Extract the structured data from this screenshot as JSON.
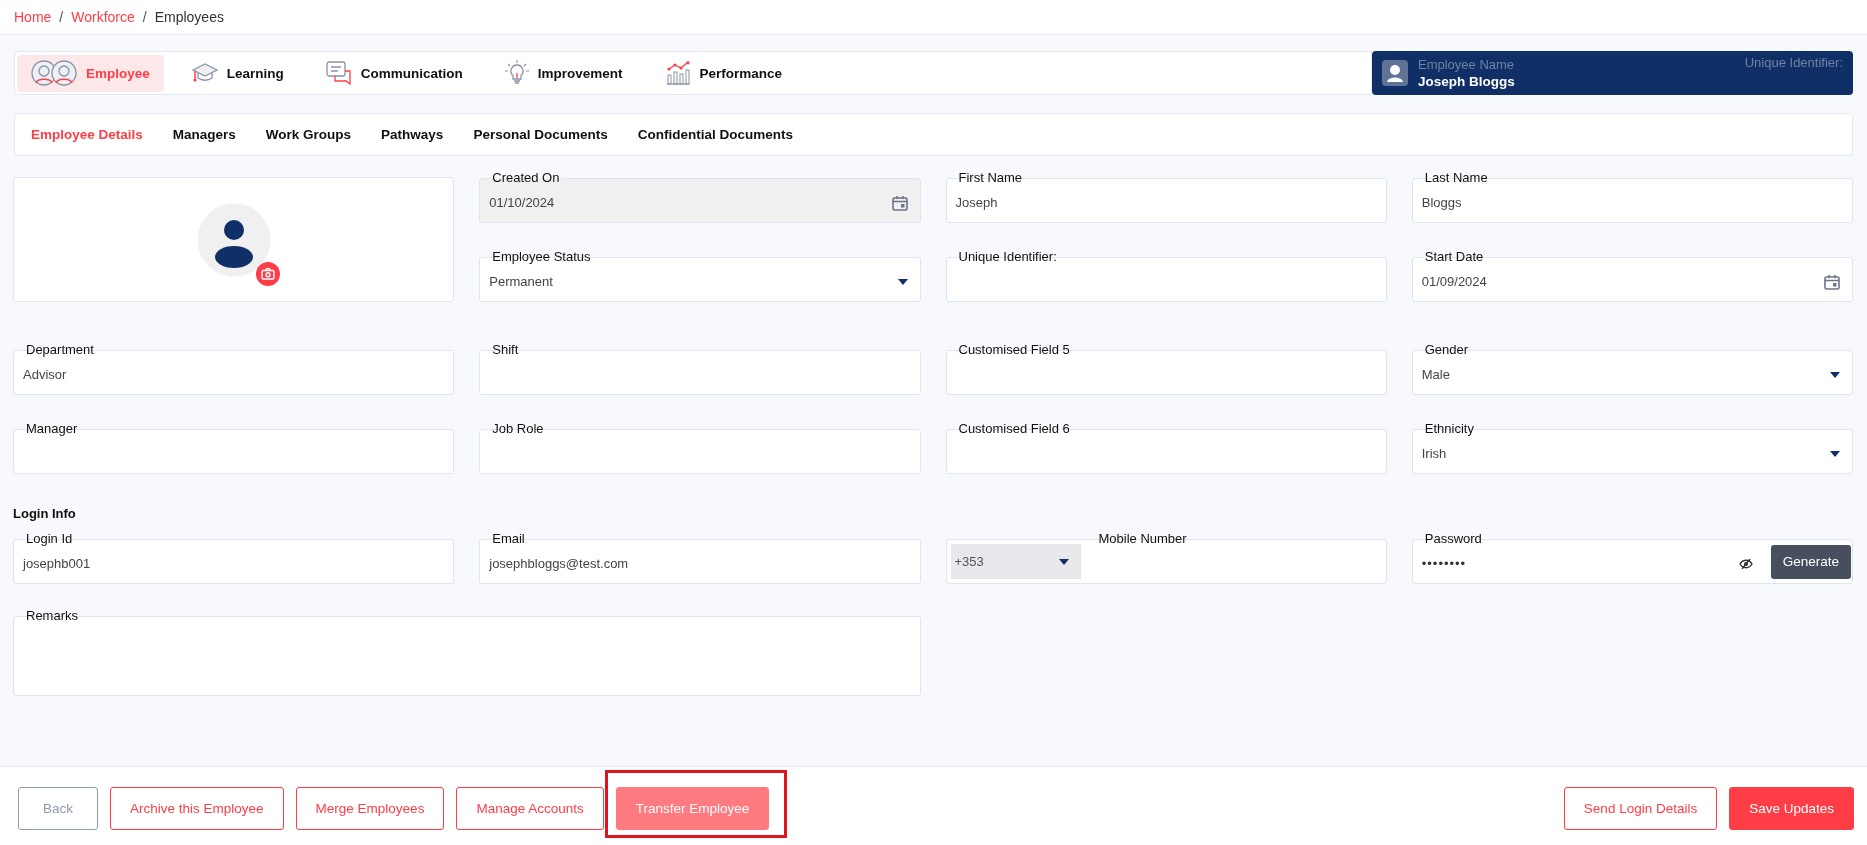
{
  "breadcrumb": [
    {
      "label": "Home",
      "kind": "link"
    },
    {
      "label": "Workforce",
      "kind": "link",
      "separator": "/"
    },
    {
      "label": "Employees",
      "kind": "current",
      "separator": "/"
    }
  ],
  "modules": [
    {
      "label": "Employee",
      "selected": true
    },
    {
      "label": "Learning",
      "selected": false
    },
    {
      "label": "Communication",
      "selected": false
    },
    {
      "label": "Improvement",
      "selected": false
    },
    {
      "label": "Performance",
      "selected": false
    }
  ],
  "employee_card": {
    "name_label": "Employee Name",
    "name": "Joseph Bloggs",
    "id_label": "Unique Identifier:"
  },
  "detail_tabs": [
    {
      "label": "Employee Details",
      "selected": true
    },
    {
      "label": "Managers",
      "selected": false
    },
    {
      "label": "Work Groups",
      "selected": false
    },
    {
      "label": "Pathways",
      "selected": false
    },
    {
      "label": "Personal Documents",
      "selected": false
    },
    {
      "label": "Confidential Documents",
      "selected": false
    }
  ],
  "profile_fields": [
    {
      "kind": "date",
      "label": "Created On",
      "value": "01/10/2024",
      "disabled": true
    },
    {
      "kind": "text",
      "label": "First Name",
      "value": "Joseph",
      "disabled": false
    },
    {
      "kind": "text",
      "label": "Last Name",
      "value": "Bloggs",
      "disabled": false
    },
    {
      "kind": "select",
      "label": "Employee Status",
      "value": "Permanent",
      "disabled": false
    },
    {
      "kind": "text",
      "label": "Unique Identifier:",
      "disabled": false
    },
    {
      "kind": "date",
      "label": "Start Date",
      "value": "01/09/2024",
      "disabled": false
    }
  ],
  "work_fields": [
    {
      "kind": "text",
      "label": "Department",
      "value": "Advisor"
    },
    {
      "kind": "text",
      "label": "Shift"
    },
    {
      "kind": "text",
      "label": "Customised Field 5"
    },
    {
      "kind": "select",
      "label": "Gender",
      "value": "Male"
    },
    {
      "kind": "text",
      "label": "Manager"
    },
    {
      "kind": "text",
      "label": "Job Role"
    },
    {
      "kind": "text",
      "label": "Customised Field 6"
    },
    {
      "kind": "select",
      "label": "Ethnicity",
      "value": "Irish"
    }
  ],
  "login_info": {
    "title": "Login Info",
    "fields": [
      {
        "kind": "text",
        "label": "Login Id",
        "value": "josephb001"
      },
      {
        "kind": "text",
        "label": "Email",
        "value": "josephbloggs@test.com"
      },
      {
        "kind": "phone",
        "label": "Mobile Number",
        "country_code": "+353"
      },
      {
        "kind": "password",
        "label": "Password",
        "value": "••••••••",
        "button": "Generate"
      }
    ]
  },
  "remarks": {
    "label": "Remarks"
  },
  "actions": [
    {
      "label": "Back",
      "kind": "secondary",
      "highlighted": false
    },
    {
      "label": "Archive this Employee",
      "kind": "outline",
      "highlighted": false
    },
    {
      "label": "Merge Employees",
      "kind": "outline",
      "highlighted": false
    },
    {
      "label": "Manage Accounts",
      "kind": "outline",
      "highlighted": false
    },
    {
      "label": "Transfer Employee",
      "kind": "muted",
      "highlighted": true
    }
  ],
  "side_actions": [
    {
      "label": "Send Login Details",
      "kind": "outline"
    },
    {
      "label": "Save Updates",
      "kind": "primary"
    }
  ]
}
